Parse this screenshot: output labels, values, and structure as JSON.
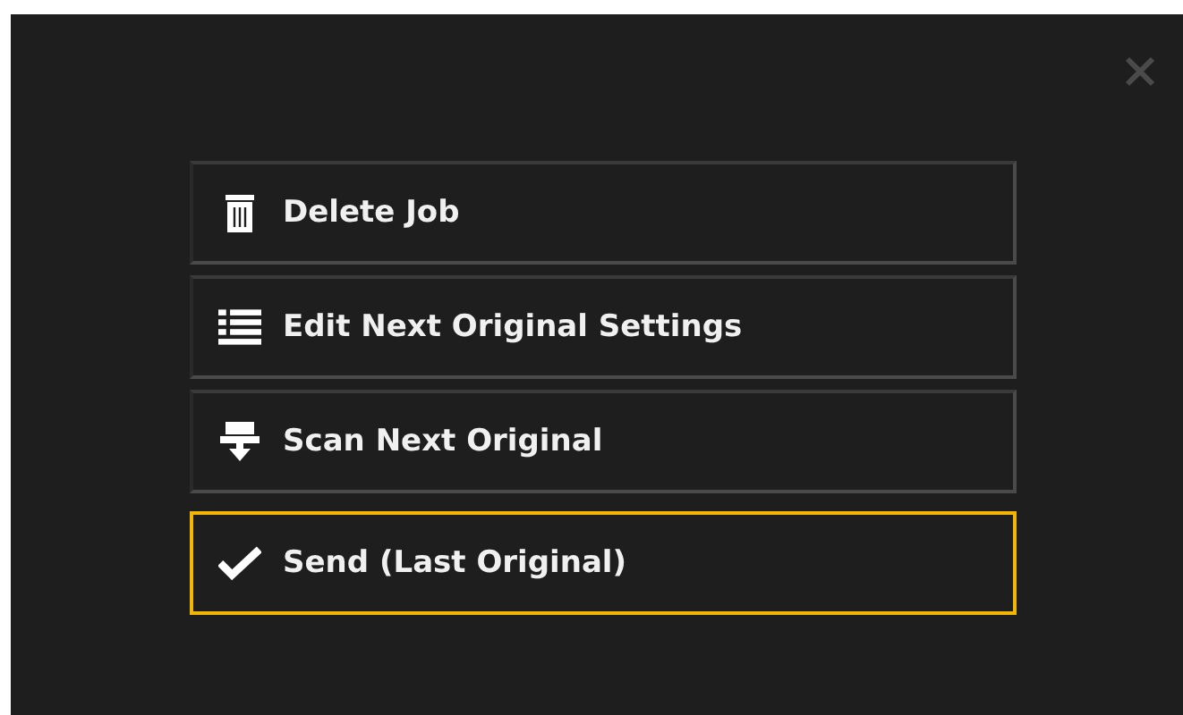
{
  "menu": {
    "items": [
      {
        "kind": "delete",
        "label": "Delete Job",
        "selected": false
      },
      {
        "kind": "edit",
        "label": "Edit Next Original Settings",
        "selected": false
      },
      {
        "kind": "scan",
        "label": "Scan Next Original",
        "selected": false
      },
      {
        "kind": "send",
        "label": "Send (Last Original)",
        "selected": true
      }
    ]
  }
}
